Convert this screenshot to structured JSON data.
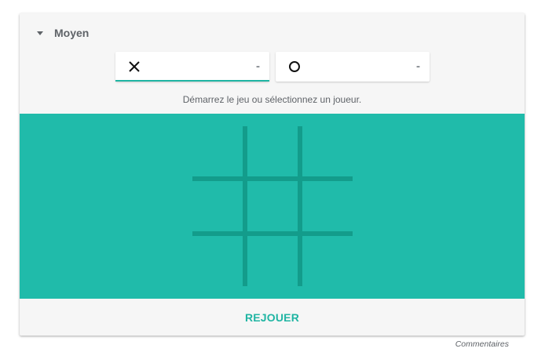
{
  "difficulty": {
    "label": "Moyen",
    "icon": "dropdown-caret-icon"
  },
  "players": [
    {
      "symbol": "X",
      "icon": "x-mark-icon",
      "score": "-",
      "active": true
    },
    {
      "symbol": "O",
      "icon": "circle-icon",
      "score": "-",
      "active": false
    }
  ],
  "status": "Démarrez le jeu ou sélectionnez un joueur.",
  "board": {
    "cells": [
      "",
      "",
      "",
      "",
      "",
      "",
      "",
      "",
      ""
    ],
    "background_color": "#20bbaa",
    "line_color": "#139c8b"
  },
  "actions": {
    "replay_label": "REJOUER"
  },
  "footer": {
    "feedback_label": "Commentaires"
  },
  "colors": {
    "accent": "#1fb5a3",
    "card_background": "#f6f6f6"
  }
}
